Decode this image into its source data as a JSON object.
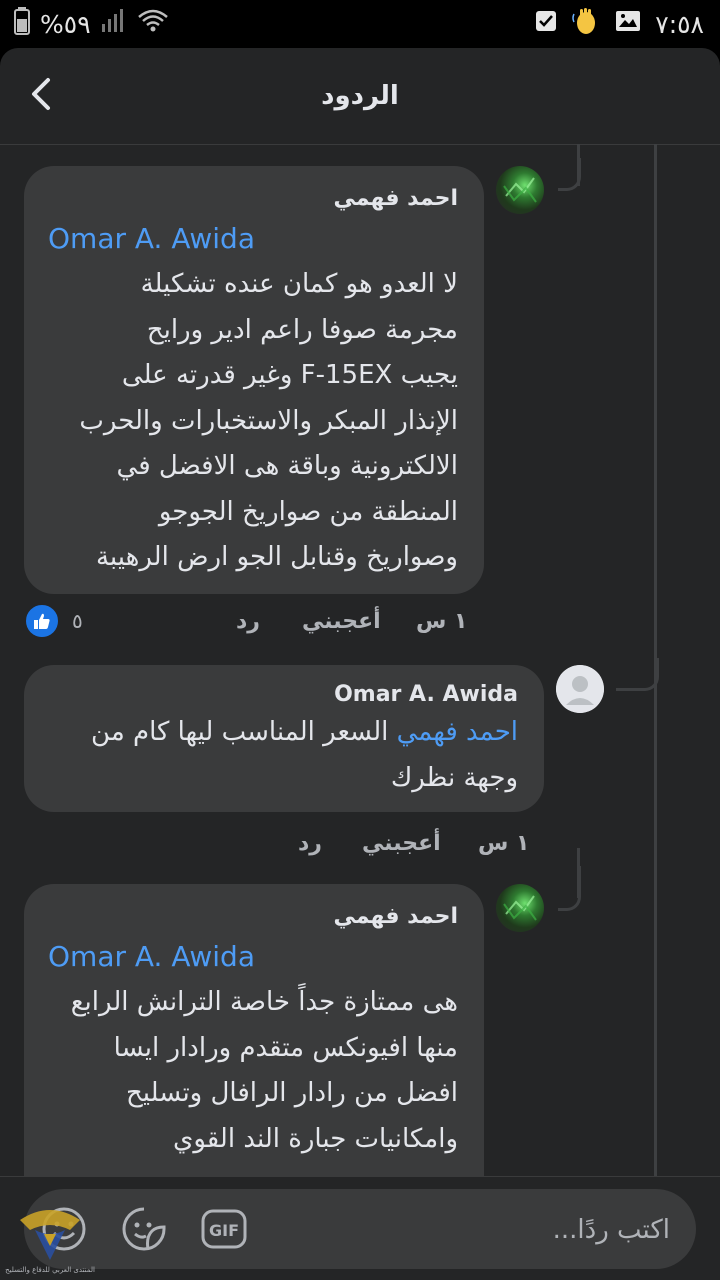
{
  "status_bar": {
    "time": "٧:٥٨",
    "battery": "%٥٩"
  },
  "header": {
    "title": "الردود"
  },
  "comments": [
    {
      "author": "احمد فهمي",
      "mention": "Omar A. Awida",
      "lines": [
        "لا العدو هو كمان عنده تشكيلة",
        "مجرمة صوفا راعم ادير ورايح",
        "يجيب F-15EX وغير قدرته على",
        "الإنذار المبكر والاستخبارات والحرب",
        "الالكترونية وباقة هى الافضل في",
        "المنطقة من صواريخ الجوجو",
        "وصواريخ وقنابل الجو ارض الرهيبة"
      ],
      "time": "١ س",
      "like_label": "أعجبني",
      "reply_label": "رد",
      "reaction_count": "٥",
      "avatar_icon": "profile-photo-green"
    },
    {
      "author": "Omar A. Awida",
      "inline_mention": "احمد فهمي",
      "line1_rest": " السعر المناسب ليها كام من",
      "line2": "وجهة نظرك",
      "time": "١ س",
      "like_label": "أعجبني",
      "reply_label": "رد",
      "avatar_icon": "default-avatar-icon"
    },
    {
      "author": "احمد فهمي",
      "mention": "Omar A. Awida",
      "lines": [
        "هى ممتازة جداً خاصة الترانش الرابع",
        "منها افيونكس متقدم ورادار ايسا",
        "افضل من رادار الرافال وتسليح",
        "وامكانيات جبارة الند القوي"
      ],
      "avatar_icon": "profile-photo-green"
    }
  ],
  "composer": {
    "placeholder": "اكتب ردًا...",
    "gif_label": "GIF"
  },
  "watermark": {
    "text": "المنتدى العربي للدفاع والتسليح"
  },
  "colors": {
    "background": "#242526",
    "bubble": "#3a3b3c",
    "text": "#e4e6eb",
    "secondary_text": "#b0b3b8",
    "link": "#4e9cf5",
    "like_blue": "#1b74e4"
  }
}
